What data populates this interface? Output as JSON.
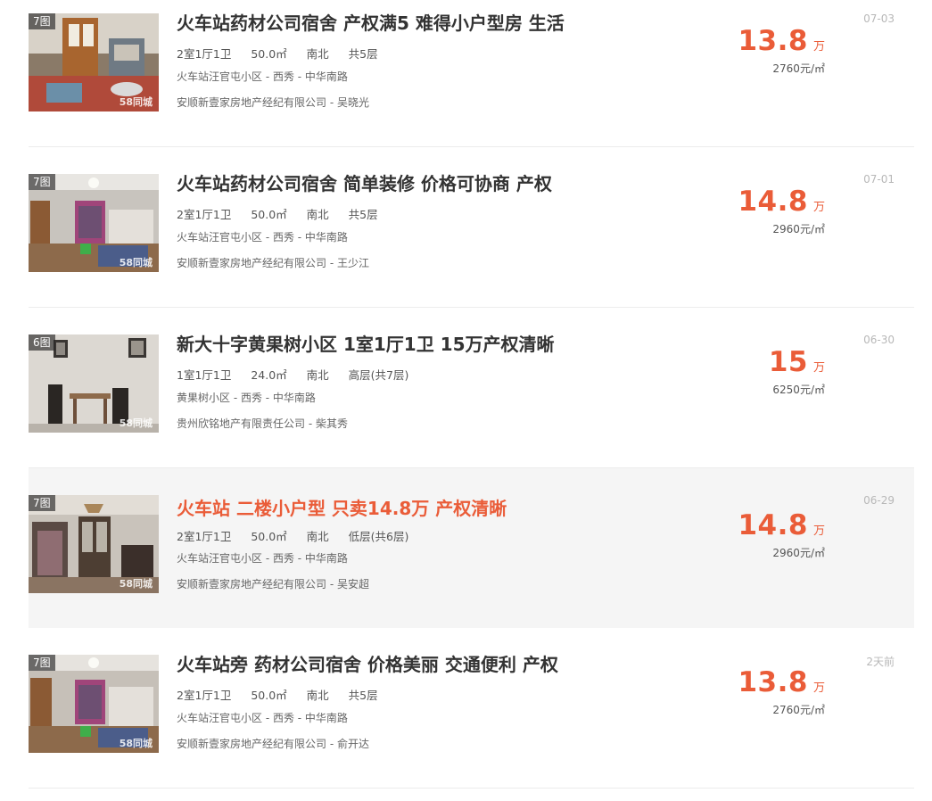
{
  "listings": [
    {
      "photo_count": "7图",
      "watermark": "58同城",
      "title": "火车站药材公司宿舍 产权满5 难得小户型房 生活",
      "layout": "2室1厅1卫",
      "area": "50.0㎡",
      "orientation": "南北",
      "floor": "共5层",
      "address": "火车站汪官屯小区 - 西秀 - 中华南路",
      "agent": "安顺新壹家房地产经纪有限公司 - 吴晓光",
      "price": "13.8",
      "price_unit": "万",
      "unit_price": "2760元/㎡",
      "date": "07-03",
      "highlighted": false
    },
    {
      "photo_count": "7图",
      "watermark": "58同城",
      "title": "火车站药材公司宿舍 简单装修 价格可协商 产权",
      "layout": "2室1厅1卫",
      "area": "50.0㎡",
      "orientation": "南北",
      "floor": "共5层",
      "address": "火车站汪官屯小区 - 西秀 - 中华南路",
      "agent": "安顺新壹家房地产经纪有限公司 - 王少江",
      "price": "14.8",
      "price_unit": "万",
      "unit_price": "2960元/㎡",
      "date": "07-01",
      "highlighted": false
    },
    {
      "photo_count": "6图",
      "watermark": "58同城",
      "title": "新大十字黄果树小区 1室1厅1卫 15万产权清晰",
      "layout": "1室1厅1卫",
      "area": "24.0㎡",
      "orientation": "南北",
      "floor": "高层(共7层)",
      "address": "黄果树小区 - 西秀 - 中华南路",
      "agent": "贵州欣铭地产有限责任公司 - 柴其秀",
      "price": "15",
      "price_unit": "万",
      "unit_price": "6250元/㎡",
      "date": "06-30",
      "highlighted": false
    },
    {
      "photo_count": "7图",
      "watermark": "58同城",
      "title": "火车站 二楼小户型 只卖14.8万 产权清晰",
      "layout": "2室1厅1卫",
      "area": "50.0㎡",
      "orientation": "南北",
      "floor": "低层(共6层)",
      "address": "火车站汪官屯小区 - 西秀 - 中华南路",
      "agent": "安顺新壹家房地产经纪有限公司 - 吴安超",
      "price": "14.8",
      "price_unit": "万",
      "unit_price": "2960元/㎡",
      "date": "06-29",
      "highlighted": true
    },
    {
      "photo_count": "7图",
      "watermark": "58同城",
      "title": "火车站旁 药材公司宿舍 价格美丽 交通便利 产权",
      "layout": "2室1厅1卫",
      "area": "50.0㎡",
      "orientation": "南北",
      "floor": "共5层",
      "address": "火车站汪官屯小区 - 西秀 - 中华南路",
      "agent": "安顺新壹家房地产经纪有限公司 - 俞开达",
      "price": "13.8",
      "price_unit": "万",
      "unit_price": "2760元/㎡",
      "date": "2天前",
      "highlighted": false
    }
  ],
  "colors": {
    "price": "#ea5c38",
    "highlight_bg": "#f5f5f5",
    "title": "#333333",
    "date": "#b8b8b8"
  }
}
